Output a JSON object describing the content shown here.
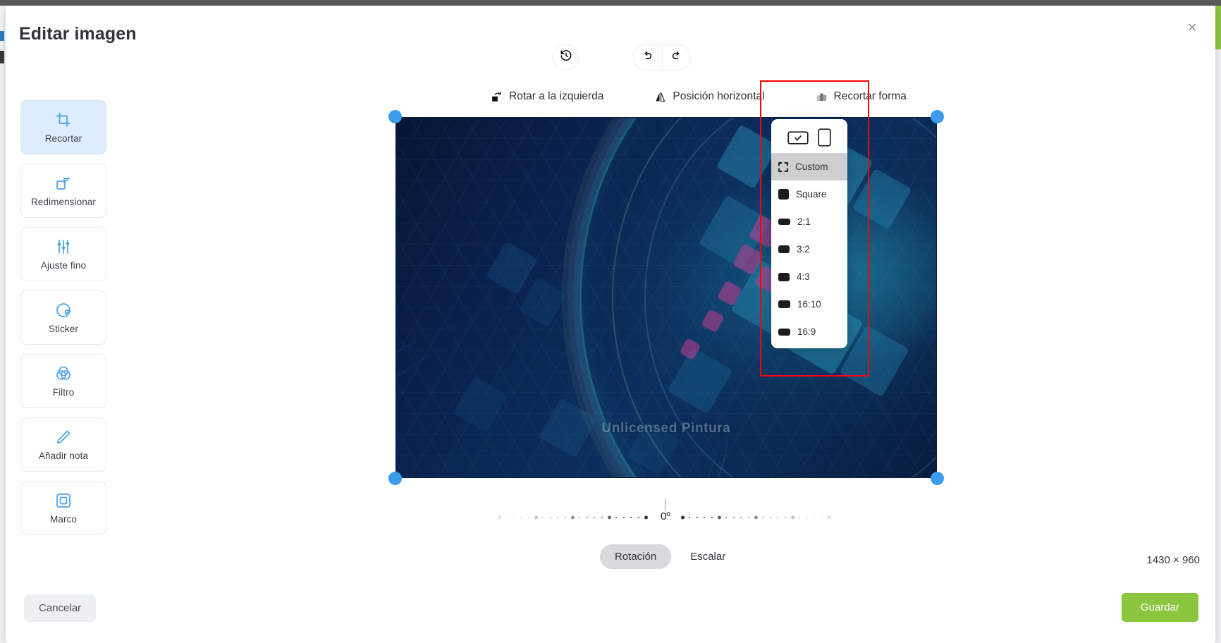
{
  "window": {
    "title": "Editar imagen",
    "close_label": "×"
  },
  "sidebar": {
    "items": [
      {
        "label": "Recortar",
        "icon": "crop-icon",
        "active": true
      },
      {
        "label": "Redimensionar",
        "icon": "resize-icon",
        "active": false
      },
      {
        "label": "Ajuste fino",
        "icon": "sliders-icon",
        "active": false
      },
      {
        "label": "Sticker",
        "icon": "sticker-icon",
        "active": false
      },
      {
        "label": "Filtro",
        "icon": "filter-icon",
        "active": false
      },
      {
        "label": "Añadir nota",
        "icon": "pencil-icon",
        "active": false
      },
      {
        "label": "Marco",
        "icon": "frame-icon",
        "active": false
      }
    ]
  },
  "toolbar": {
    "history_icon": "history-icon",
    "undo_icon": "undo-icon",
    "redo_icon": "redo-icon",
    "actions": [
      {
        "label": "Rotar a la izquierda",
        "icon": "rotate-left-icon",
        "highlighted": false
      },
      {
        "label": "Posición horizontal",
        "icon": "flip-horizontal-icon",
        "highlighted": false
      },
      {
        "label": "Recortar forma",
        "icon": "crop-shape-icon",
        "highlighted": true
      }
    ]
  },
  "crop_dropdown": {
    "orientation": [
      {
        "name": "landscape-orientation",
        "selected": true
      },
      {
        "name": "portrait-orientation",
        "selected": false
      }
    ],
    "ratios": [
      {
        "label": "Custom",
        "shape": "custom",
        "selected": true,
        "w": 14,
        "h": 14
      },
      {
        "label": "Square",
        "shape": "square",
        "selected": false,
        "w": 15,
        "h": 15
      },
      {
        "label": "2:1",
        "shape": "rect",
        "selected": false,
        "w": 17,
        "h": 9
      },
      {
        "label": "3:2",
        "shape": "rect",
        "selected": false,
        "w": 16,
        "h": 11
      },
      {
        "label": "4:3",
        "shape": "rect",
        "selected": false,
        "w": 16,
        "h": 12
      },
      {
        "label": "16:10",
        "shape": "rect",
        "selected": false,
        "w": 17,
        "h": 11
      },
      {
        "label": "16:9",
        "shape": "rect",
        "selected": false,
        "w": 17,
        "h": 10
      }
    ]
  },
  "canvas": {
    "watermark": "Unlicensed Pintura",
    "handle_color": "#3d9bec",
    "crop_handles": [
      "top-left",
      "top-right",
      "bottom-left",
      "bottom-right"
    ]
  },
  "rotation": {
    "value_label": "0º",
    "value": 0
  },
  "mode_tabs": [
    {
      "label": "Rotación",
      "active": true
    },
    {
      "label": "Escalar",
      "active": false
    }
  ],
  "footer": {
    "dimensions": "1430 × 960",
    "cancel_label": "Cancelar",
    "save_label": "Guardar",
    "save_color": "#8cc63f"
  }
}
